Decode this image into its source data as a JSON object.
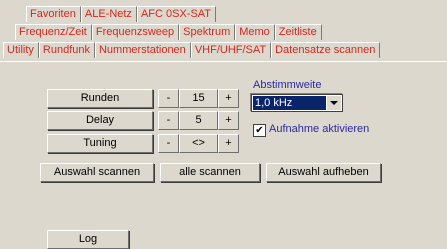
{
  "tabs": {
    "row1": [
      "Favoriten",
      "ALE-Netz",
      "AFC 0SX-SAT"
    ],
    "row2": [
      "Frequenz/Zeit",
      "Frequenzsweep",
      "Spektrum",
      "Memo",
      "Zeitliste"
    ],
    "row3": [
      "Utility",
      "Rundfunk",
      "Nummerstationen",
      "VHF/UHF/SAT",
      "Datensatze scannen"
    ],
    "active": "Datensatze scannen"
  },
  "controls": {
    "runden": {
      "label": "Runden",
      "minus": "-",
      "value": "15",
      "plus": "+"
    },
    "delay": {
      "label": "Delay",
      "minus": "-",
      "value": "5",
      "plus": "+"
    },
    "tuning": {
      "label": "Tuning",
      "minus": "-",
      "value": "<>",
      "plus": "+"
    }
  },
  "abstimmweite": {
    "label": "Abstimmweite",
    "value": "1,0 kHz"
  },
  "aufnahme": {
    "label": "Aufnahme aktivieren",
    "checked": true,
    "mark": "✔"
  },
  "actions": {
    "auswahl_scannen": "Auswahl scannen",
    "alle_scannen": "alle scannen",
    "auswahl_aufheben": "Auswahl aufheben"
  },
  "log_label": "Log",
  "colors": {
    "tab_text": "#d8261d",
    "label_blue": "#2a2aa0",
    "background": "#dcd8cd",
    "selection": "#0a246a"
  }
}
